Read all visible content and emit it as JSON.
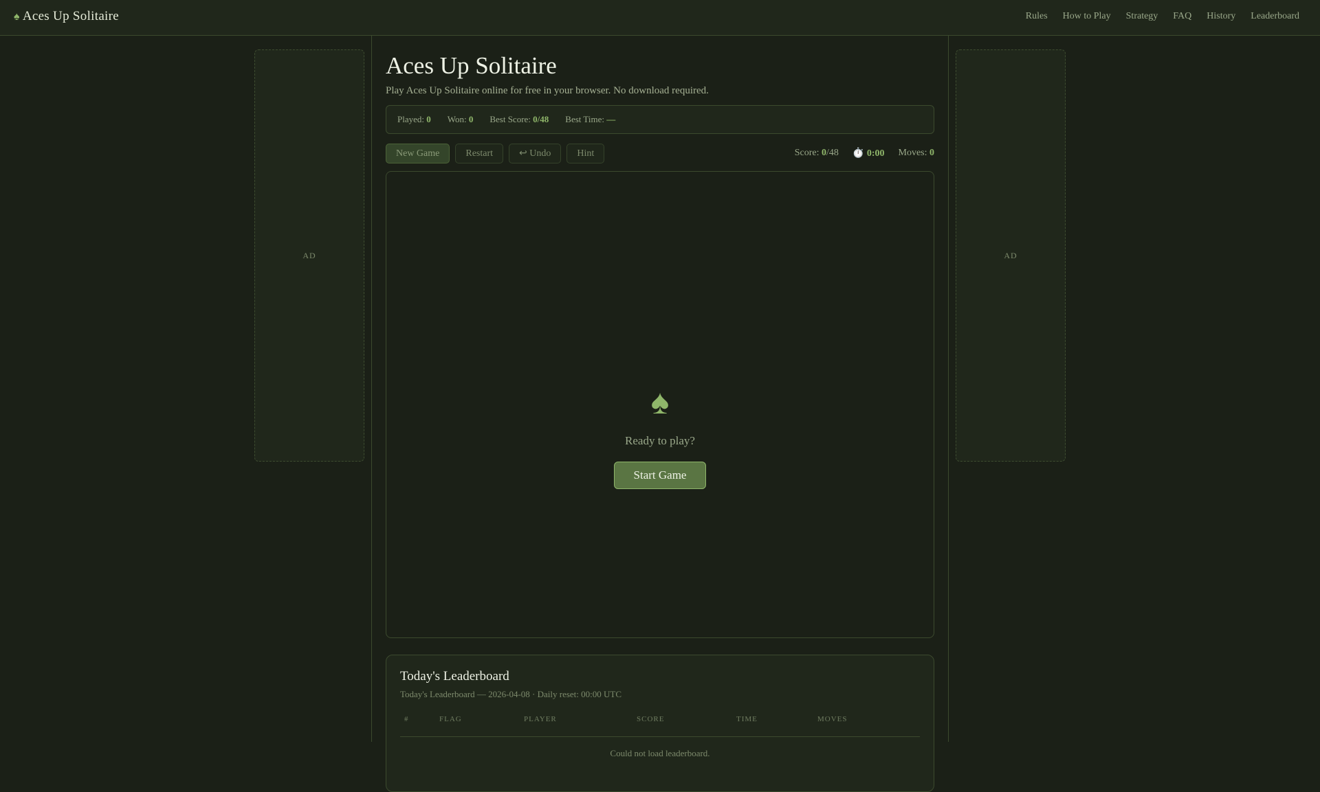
{
  "header": {
    "logo_icon": "spade-icon",
    "logo": "Aces Up Solitaire",
    "nav": [
      "Rules",
      "How to Play",
      "Strategy",
      "FAQ",
      "History",
      "Leaderboard"
    ]
  },
  "ads": {
    "left": "AD",
    "right": "AD"
  },
  "main": {
    "title": "Aces Up Solitaire",
    "subtitle": "Play Aces Up Solitaire online for free in your browser. No download required."
  },
  "stats": {
    "played_label": "Played:",
    "played": "0",
    "won_label": "Won:",
    "won": "0",
    "best_score_label": "Best Score:",
    "best_score": "0/48",
    "best_time_label": "Best Time:",
    "best_time": "—"
  },
  "toolbar": {
    "new_game": "New Game",
    "restart": "Restart",
    "undo": "↩ Undo",
    "hint": "Hint"
  },
  "hud": {
    "score_label": "Score:",
    "score": "0",
    "score_max": "/48",
    "timer_icon": "⏱️",
    "time": "0:00",
    "moves_label": "Moves:",
    "moves": "0"
  },
  "board": {
    "icon": "♠",
    "ready": "Ready to play?",
    "start": "Start Game"
  },
  "leaderboard": {
    "title": "Today's Leaderboard",
    "meta": "Today's Leaderboard — 2026-04-08 · Daily reset: 00:00 UTC",
    "columns": [
      "#",
      "FLAG",
      "PLAYER",
      "SCORE",
      "TIME",
      "MOVES"
    ],
    "empty": "Could not load leaderboard."
  }
}
